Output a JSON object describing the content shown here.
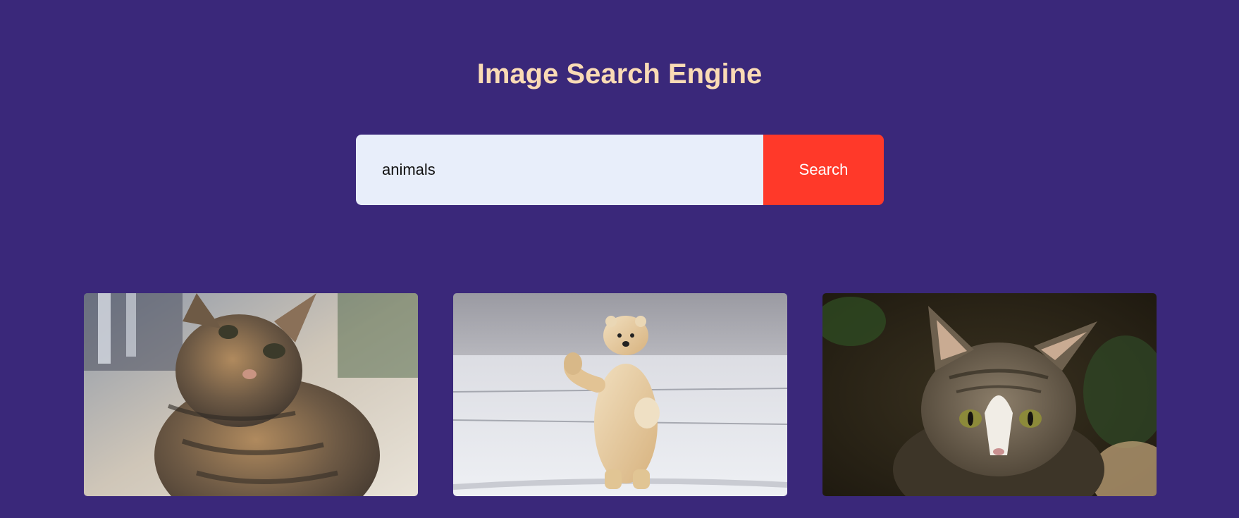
{
  "header": {
    "title": "Image Search Engine"
  },
  "search": {
    "value": "animals",
    "placeholder": "",
    "button_label": "Search"
  },
  "results": [
    {
      "subject": "tabby-kitten"
    },
    {
      "subject": "polar-bear-waving"
    },
    {
      "subject": "tabby-cat-white-chest"
    }
  ],
  "colors": {
    "background": "#3a287a",
    "title": "#fadbb5",
    "input_bg": "#e8eefa",
    "button_bg": "#ff3929",
    "button_text": "#ffffff"
  }
}
